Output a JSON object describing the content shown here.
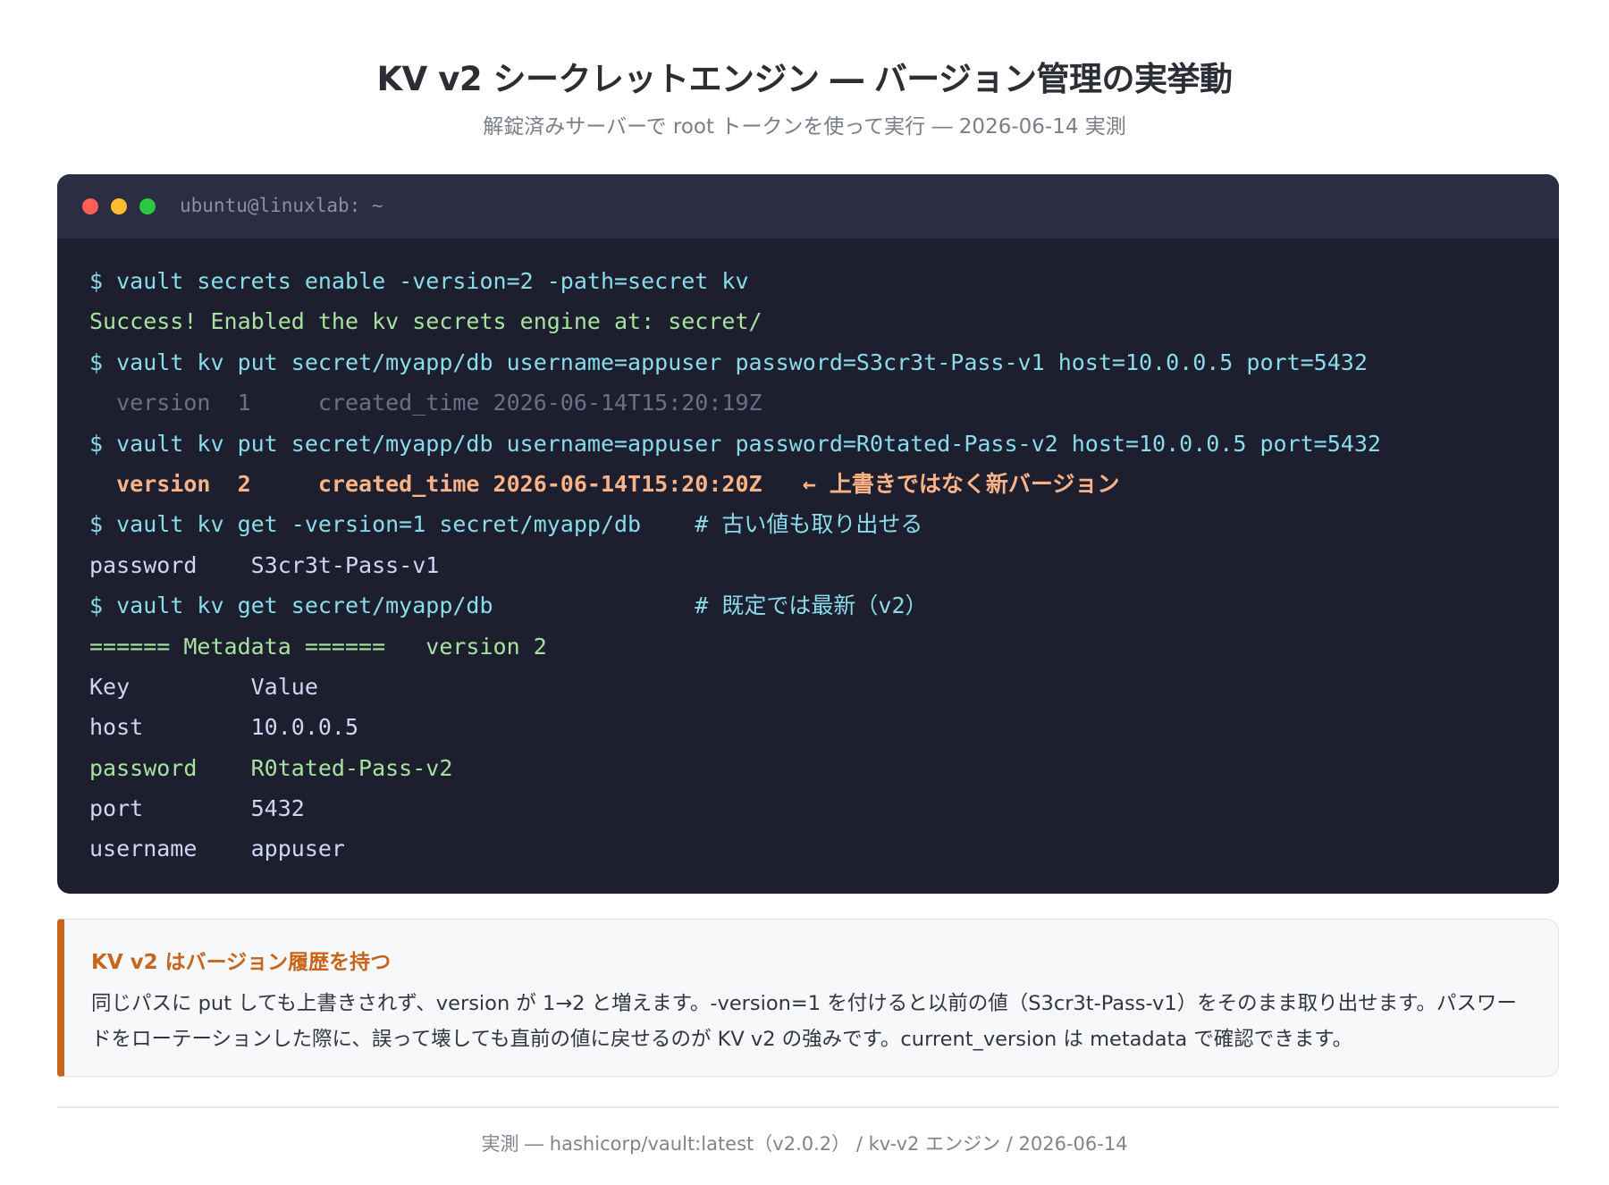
{
  "header": {
    "title": "KV v2 シークレットエンジン ― バージョン管理の実挙動",
    "subtitle": "解錠済みサーバーで root トークンを使って実行 ― 2026-06-14 実測"
  },
  "terminal": {
    "title": "ubuntu@linuxlab: ~",
    "lines": [
      "$ vault secrets enable -version=2 -path=secret kv",
      "Success! Enabled the kv secrets engine at: secret/",
      "$ vault kv put secret/myapp/db username=appuser password=S3cr3t-Pass-v1 host=10.0.0.5 port=5432",
      "  version  1     created_time 2026-06-14T15:20:19Z",
      "$ vault kv put secret/myapp/db username=appuser password=R0tated-Pass-v2 host=10.0.0.5 port=5432",
      "  version  2     created_time 2026-06-14T15:20:20Z   ← 上書きではなく新バージョン",
      "$ vault kv get -version=1 secret/myapp/db    # 古い値も取り出せる",
      "password    S3cr3t-Pass-v1",
      "$ vault kv get secret/myapp/db               # 既定では最新（v2）",
      "====== Metadata ======   version 2",
      "Key         Value",
      "host        10.0.0.5",
      "password    R0tated-Pass-v2",
      "port        5432",
      "username    appuser"
    ]
  },
  "note": {
    "title": "KV v2 はバージョン履歴を持つ",
    "text": "同じパスに put しても上書きされず、version が 1→2 と増えます。-version=1 を付けると以前の値（S3cr3t-Pass-v1）をそのまま取り出せます。パスワードをローテーションした際に、誤って壊しても直前の値に戻せるのが KV v2 の強みです。current_version は metadata で確認できます。"
  },
  "footer": {
    "text": "実測 ― hashicorp/vault:latest（v2.0.2） / kv-v2 エンジン / 2026-06-14"
  },
  "colors": {
    "terminal_bg": "#1e1f2e",
    "terminal_bar": "#2b2d42",
    "command": "#89dceb",
    "success": "#a6e3a1",
    "highlight": "#fab387",
    "accent": "#c8651b"
  }
}
